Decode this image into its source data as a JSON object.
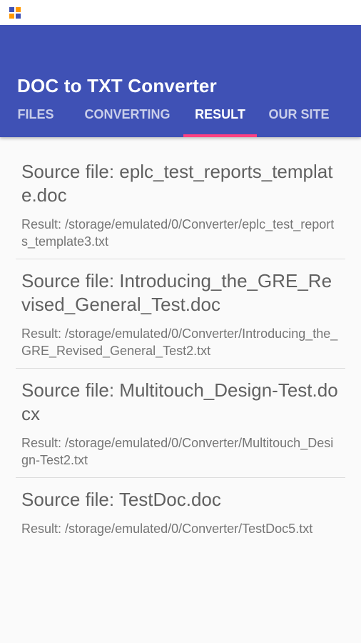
{
  "app": {
    "title": "DOC to TXT Converter"
  },
  "status_bar": {
    "icon": "app-notification-icon"
  },
  "tabs": [
    {
      "label": "FILES",
      "active": false
    },
    {
      "label": "CONVERTING",
      "active": false
    },
    {
      "label": "RESULT",
      "active": true
    },
    {
      "label": "OUR SITE",
      "active": false
    }
  ],
  "colors": {
    "primary": "#3f51b5",
    "accent": "#ff4081"
  },
  "results": [
    {
      "source": "Source file: eplc_test_reports_template.doc",
      "result": "Result: /storage/emulated/0/Converter/eplc_test_reports_template3.txt"
    },
    {
      "source": "Source file: Introducing_the_GRE_Revised_General_Test.doc",
      "result": "Result: /storage/emulated/0/Converter/Introducing_the_GRE_Revised_General_Test2.txt"
    },
    {
      "source": "Source file: Multitouch_Design-Test.docx",
      "result": "Result: /storage/emulated/0/Converter/Multitouch_Design-Test2.txt"
    },
    {
      "source": "Source file: TestDoc.doc",
      "result": "Result: /storage/emulated/0/Converter/TestDoc5.txt"
    }
  ]
}
